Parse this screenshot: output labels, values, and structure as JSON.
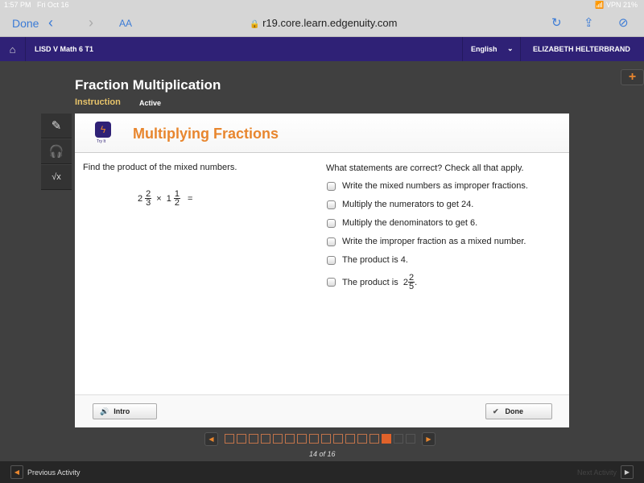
{
  "status": {
    "time": "1:57 PM",
    "date": "Fri Oct 16",
    "battery": "21%",
    "vpn": "VPN"
  },
  "browser": {
    "done": "Done",
    "back": "‹",
    "forward": "›",
    "text_size": "AA",
    "url": "r19.core.learn.edgenuity.com",
    "lock": "🔒",
    "reload": "↻",
    "share": "⇪",
    "compass": "⊘"
  },
  "nav": {
    "home": "⌂",
    "course": "LISD V Math 6 T1",
    "language": "English",
    "chevron": "⌄",
    "user": "ELIZABETH HELTERBRAND"
  },
  "plus": "+",
  "header": {
    "title": "Fraction Multiplication",
    "section": "Instruction",
    "state": "Active"
  },
  "tools": {
    "pencil": "✎",
    "headphones": "🎧",
    "calculator": "√x"
  },
  "card": {
    "logo_glyph": "ϟ",
    "logo_label": "Try It",
    "title": "Multiplying Fractions",
    "prompt": "Find the product of the mixed numbers.",
    "expr": {
      "w1": "2",
      "n1": "2",
      "d1": "3",
      "op": "×",
      "w2": "1",
      "n2": "1",
      "d2": "2",
      "eq": "="
    },
    "question": "What statements are correct? Check all that apply.",
    "options": [
      "Write the mixed numbers as improper fractions.",
      "Multiply the numerators to get 24.",
      "Multiply the denominators to get 6.",
      "Write the improper fraction as a mixed number.",
      "The product is 4.",
      "The product is"
    ],
    "last_frac": {
      "w": "2",
      "n": "2",
      "d": "5",
      "end": "."
    },
    "intro": "Intro",
    "intro_icon": "🔊",
    "done": "Done",
    "done_icon": "✔"
  },
  "pager": {
    "prev": "◀",
    "next": "▶",
    "count": "14 of 16",
    "current": 14,
    "total": 16
  },
  "bottom": {
    "prev": "Previous Activity",
    "next": "Next Activity",
    "prev_icon": "◀",
    "next_icon": "▶"
  }
}
